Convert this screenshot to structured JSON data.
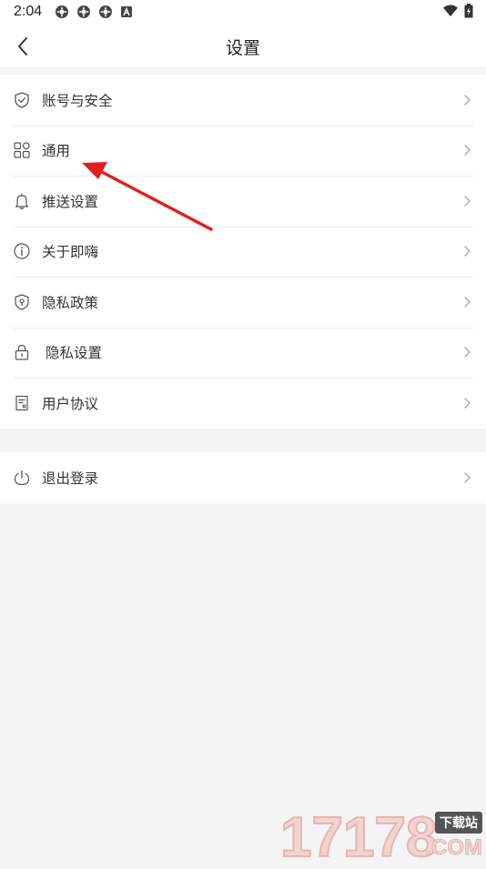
{
  "status_bar": {
    "time": "2:04",
    "left_icons": [
      "settings-gear-icon",
      "settings-gear-icon",
      "settings-gear-icon",
      "a-badge-icon"
    ],
    "right_icons": [
      "wifi-icon",
      "battery-charging-icon"
    ]
  },
  "header": {
    "title": "设置",
    "back_icon": "chevron-left-icon"
  },
  "menu_group_1": [
    {
      "label": "账号与安全",
      "icon": "shield-check-icon"
    },
    {
      "label": "通用",
      "icon": "grid-icon"
    },
    {
      "label": "推送设置",
      "icon": "bell-icon"
    },
    {
      "label": "关于即嗨",
      "icon": "info-icon"
    },
    {
      "label": "隐私政策",
      "icon": "privacy-shield-icon"
    },
    {
      "label": "隐私设置",
      "icon": "lock-icon"
    },
    {
      "label": "用户协议",
      "icon": "document-icon"
    }
  ],
  "menu_group_2": [
    {
      "label": "退出登录",
      "icon": "power-icon"
    }
  ],
  "annotation": {
    "arrow_color": "#e02020"
  },
  "watermark": {
    "digits": "17178",
    "tag": "下载站",
    "domain": ".COM"
  },
  "colors": {
    "background": "#f4f4f4",
    "surface": "#ffffff",
    "text": "#333333",
    "divider": "#ededed",
    "chevron": "#a8a8a8"
  }
}
